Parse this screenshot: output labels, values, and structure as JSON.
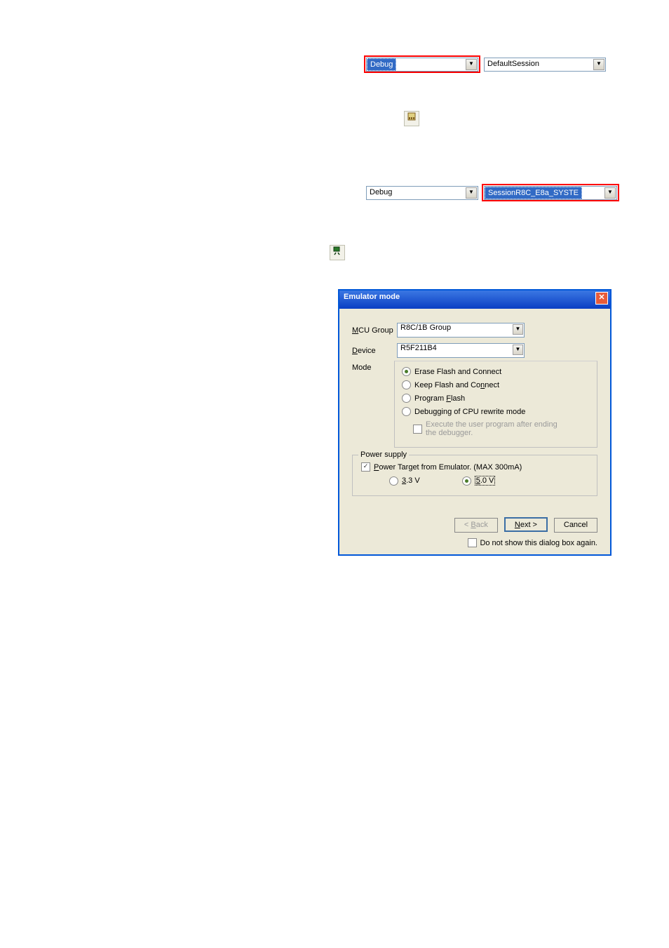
{
  "toolbar1": {
    "config": "Debug",
    "session": "DefaultSession"
  },
  "toolbar2": {
    "config": "Debug",
    "session": "SessionR8C_E8a_SYSTE"
  },
  "dialog": {
    "title": "Emulator mode",
    "mcu_label": "MCU Group",
    "mcu_value": "R8C/1B Group",
    "device_label": "Device",
    "device_value": "R5F211B4",
    "mode_label": "Mode",
    "mode_opts": {
      "erase": "Erase Flash and Connect",
      "keep": "Keep Flash and Connect",
      "prog": "Program Flash",
      "dbg": "Debugging of CPU rewrite mode"
    },
    "exec_after": "Execute the user program after ending the debugger.",
    "ps_legend": "Power supply",
    "ps_target": "Power Target from Emulator. (MAX 300mA)",
    "v33": "3.3 V",
    "v50": "5.0 V",
    "back": "< Back",
    "next": "Next >",
    "cancel": "Cancel",
    "noshow": "Do not show this dialog box again."
  }
}
